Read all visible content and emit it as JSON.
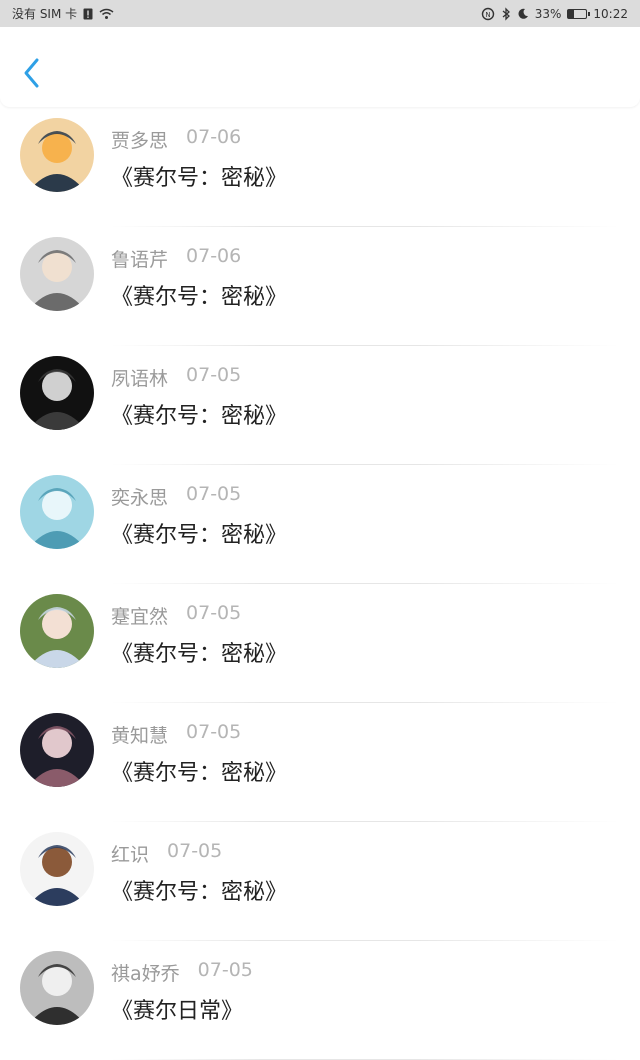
{
  "status_bar": {
    "carrier": "没有 SIM 卡",
    "battery_percent": "33%",
    "time": "10:22",
    "icons": [
      "sim-alert-icon",
      "wifi-icon",
      "nfc-icon",
      "bluetooth-icon",
      "moon-icon",
      "battery-icon"
    ]
  },
  "nav": {
    "back_icon": "chevron-left-icon",
    "accent_color": "#2ea0e6"
  },
  "items": [
    {
      "name": "贾多思",
      "date": "07-06",
      "title": "《赛尔号：密秘》",
      "avatar_colors": [
        "#f2d3a2",
        "#2b3a4a",
        "#f7b24d"
      ]
    },
    {
      "name": "鲁语芹",
      "date": "07-06",
      "title": "《赛尔号：密秘》",
      "avatar_colors": [
        "#d6d6d6",
        "#6b6b6b",
        "#f0e0d0"
      ]
    },
    {
      "name": "夙语林",
      "date": "07-05",
      "title": "《赛尔号：密秘》",
      "avatar_colors": [
        "#111111",
        "#3a3a3a",
        "#d0d0d0"
      ]
    },
    {
      "name": "奕永思",
      "date": "07-05",
      "title": "《赛尔号：密秘》",
      "avatar_colors": [
        "#9fd6e4",
        "#4e9cb4",
        "#e8f6fa"
      ]
    },
    {
      "name": "蹇宜然",
      "date": "07-05",
      "title": "《赛尔号：密秘》",
      "avatar_colors": [
        "#6a8a4a",
        "#c9d7e8",
        "#f3e0d4"
      ]
    },
    {
      "name": "黄知慧",
      "date": "07-05",
      "title": "《赛尔号：密秘》",
      "avatar_colors": [
        "#1e1e2a",
        "#8a5b6a",
        "#e1c8cc"
      ]
    },
    {
      "name": "红识",
      "date": "07-05",
      "title": "《赛尔号：密秘》",
      "avatar_colors": [
        "#f4f4f4",
        "#2c3d5e",
        "#8b5a3a"
      ]
    },
    {
      "name": "祺a妤乔",
      "date": "07-05",
      "title": "《赛尔日常》",
      "avatar_colors": [
        "#bdbdbd",
        "#2f2f2f",
        "#efefef"
      ]
    }
  ]
}
